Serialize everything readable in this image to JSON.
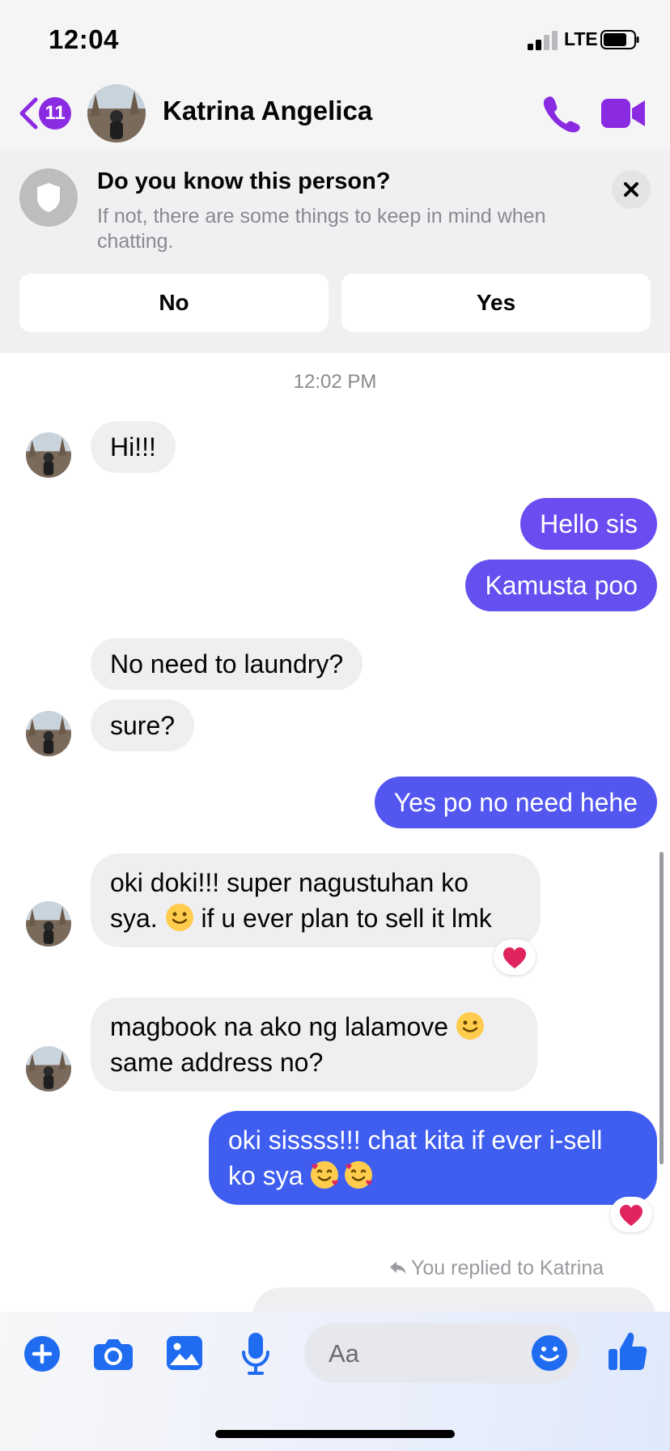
{
  "status_bar": {
    "time": "12:04",
    "network": "LTE"
  },
  "header": {
    "unread_count": "11",
    "contact_name": "Katrina Angelica"
  },
  "banner": {
    "title": "Do you know this person?",
    "text": "If not, there are some things to keep in mind when chatting.",
    "no_label": "No",
    "yes_label": "Yes"
  },
  "conversation": {
    "timestamp": "12:02 PM",
    "messages": [
      {
        "from": "them",
        "text": "Hi!!!"
      },
      {
        "from": "me",
        "text": "Hello sis"
      },
      {
        "from": "me",
        "text": "Kamusta poo"
      },
      {
        "from": "them",
        "text": "No need to laundry?"
      },
      {
        "from": "them",
        "text": "sure?"
      },
      {
        "from": "me",
        "text": "Yes po no need hehe"
      },
      {
        "from": "them",
        "line1": "oki doki!!! super nagustuhan ko",
        "line2a": "sya. ",
        "line2b": " if u ever plan to sell it lmk",
        "reaction": "heart"
      },
      {
        "from": "them",
        "line1": "magbook na ako ng lalamove ",
        "line2": "same address no?"
      },
      {
        "from": "me",
        "line1": "oki sissss!!! chat kita if ever i-sell",
        "line2": "ko sya ",
        "reaction": "heart"
      }
    ],
    "reply_note": "You replied to Katrina"
  },
  "composer": {
    "placeholder": "Aa",
    "icons": [
      "plus-icon",
      "camera-icon",
      "gallery-icon",
      "microphone-icon",
      "emoji-icon",
      "thumbs-up-icon"
    ]
  },
  "colors": {
    "accent_purple": "#8a2be2",
    "bubble_out_top": "#6a4cf0",
    "bubble_out_bottom": "#3f5ef0",
    "bubble_in": "#efeff1",
    "composer_blue": "#1f6cf0"
  }
}
